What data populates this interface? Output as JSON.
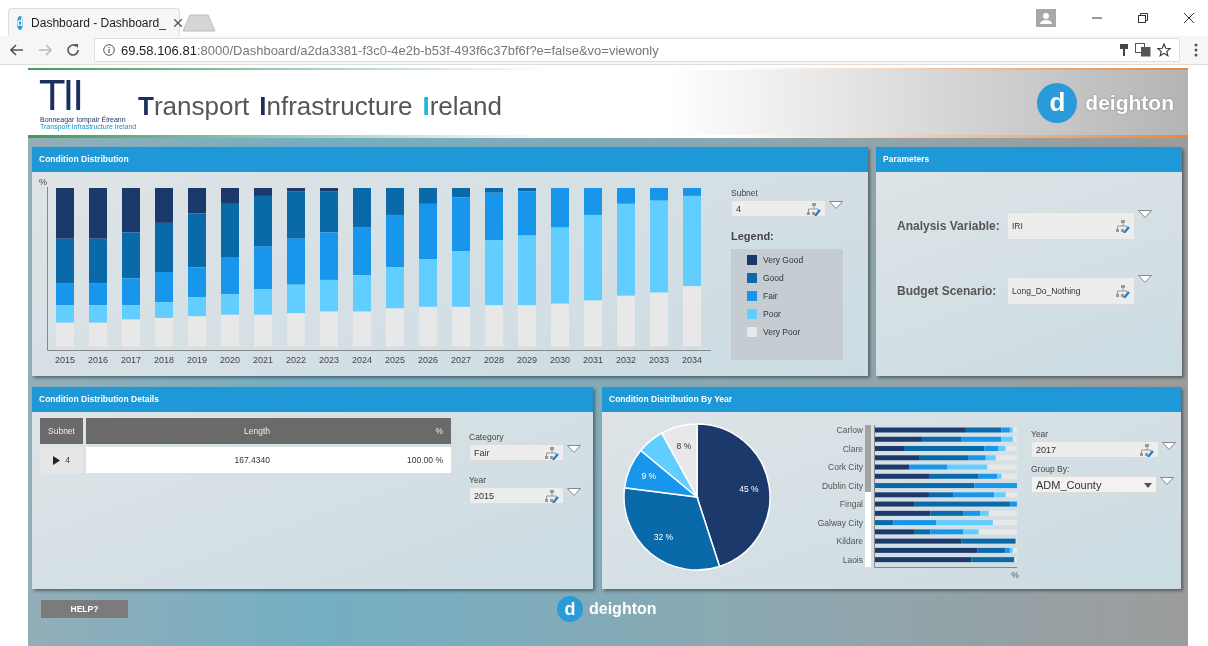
{
  "browser": {
    "favicon_mark": "d",
    "tab_title": "Dashboard - Dashboard_",
    "url_host": "69.58.106.81",
    "url_path": ":8000/Dashboard/a2da3381-f3c0-4e2b-b53f-493f6c37bf6f?e=false&vo=viewonly"
  },
  "header": {
    "logo_mark": "TII",
    "logo_line1": "Bonneagar Iompair Éireann",
    "logo_line2": "Transport Infrastructure Ireland",
    "title": [
      {
        "initial": "T",
        "rest": "ransport",
        "color": "#1b2f5e"
      },
      {
        "initial": "I",
        "rest": "nfrastructure",
        "color": "#1b2f5e"
      },
      {
        "initial": "I",
        "rest": "reland",
        "color": "#1fb8e0"
      }
    ],
    "brand": {
      "mark": "d",
      "name": "deighton"
    }
  },
  "condition_distribution": {
    "title": "Condition Distribution",
    "y_unit": "%",
    "years": [
      "2015",
      "2016",
      "2017",
      "2018",
      "2019",
      "2020",
      "2021",
      "2022",
      "2023",
      "2024",
      "2025",
      "2026",
      "2027",
      "2028",
      "2029",
      "2030",
      "2031",
      "2032",
      "2033",
      "2034"
    ],
    "subnet": {
      "label": "Subnet",
      "value": "4"
    },
    "legend": {
      "title": "Legend:",
      "items": [
        {
          "label": "Very Good",
          "color": "#1b3a6b"
        },
        {
          "label": "Good",
          "color": "#0a69a8"
        },
        {
          "label": "Fair",
          "color": "#1796ec"
        },
        {
          "label": "Poor",
          "color": "#62ceff"
        },
        {
          "label": "Very Poor",
          "color": "#e8e8e8"
        }
      ]
    }
  },
  "parameters": {
    "title": "Parameters",
    "fields": [
      {
        "label": "Analysis Variable:",
        "value": "IRI"
      },
      {
        "label": "Budget Scenario:",
        "value": "Long_Do_Nothing"
      }
    ]
  },
  "details": {
    "title": "Condition Distribution Details",
    "columns": [
      "Subnet",
      "Length",
      "%"
    ],
    "rows": [
      {
        "subnet": "4",
        "expanded": false,
        "length": "167.4340",
        "percent": "100.00 %"
      }
    ],
    "filters": [
      {
        "label": "Category",
        "value": "Fair"
      },
      {
        "label": "Year",
        "value": "2015"
      }
    ]
  },
  "by_year": {
    "title": "Condition Distribution By Year",
    "chart_data": {
      "type": "pie",
      "values": [
        45,
        32,
        9,
        6,
        8
      ],
      "value_labels": [
        "45 %",
        "32 %",
        "9 %",
        null,
        "8 %"
      ]
    },
    "bar_labels": [
      "Carlow",
      "Clare",
      "Cork City",
      "Dublin City",
      "Fingal",
      "Galway City",
      "Kildare",
      "Laois"
    ],
    "bar_unit": "%",
    "year": {
      "label": "Year",
      "value": "2017"
    },
    "group_by": {
      "label": "Group By:",
      "value": "ADM_County"
    }
  },
  "help_button": "HELP?",
  "footer_brand": {
    "mark": "d",
    "name": "deighton"
  }
}
